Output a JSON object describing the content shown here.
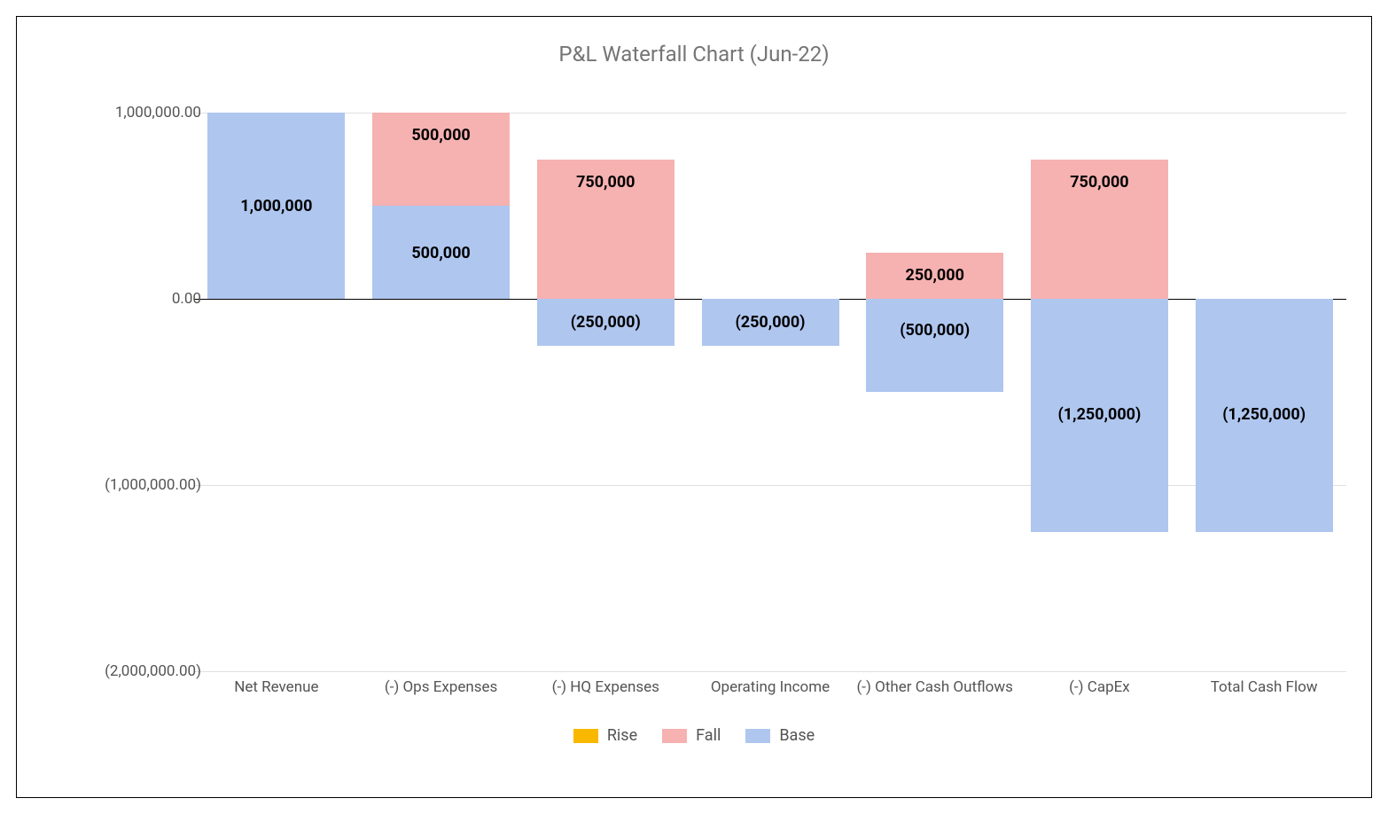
{
  "chart_data": {
    "type": "bar",
    "title": "P&L Waterfall Chart (Jun-22)",
    "ylim": [
      -2000000,
      1000000
    ],
    "yticks": [
      {
        "v": 1000000,
        "label": "1,000,000.00"
      },
      {
        "v": 0,
        "label": "0.00"
      },
      {
        "v": -1000000,
        "label": "(1,000,000.00)"
      },
      {
        "v": -2000000,
        "label": "(2,000,000.00)"
      }
    ],
    "categories": [
      "Net Revenue",
      "(-) Ops Expenses",
      "(-) HQ Expenses",
      "Operating Income",
      "(-) Other Cash Outflows",
      "(-) CapEx",
      "Total Cash Flow"
    ],
    "legend": [
      {
        "name": "Rise",
        "key": "rise"
      },
      {
        "name": "Fall",
        "key": "fall"
      },
      {
        "name": "Base",
        "key": "base"
      }
    ],
    "bars": [
      {
        "segments": [
          {
            "kind": "base",
            "from": 0,
            "to": 1000000,
            "label": "1,000,000",
            "labelAt": 500000
          }
        ]
      },
      {
        "segments": [
          {
            "kind": "base",
            "from": 0,
            "to": 500000,
            "label": "500,000",
            "labelAt": 250000
          },
          {
            "kind": "fall",
            "from": 500000,
            "to": 1000000,
            "label": "500,000",
            "labelAt": 880000
          }
        ]
      },
      {
        "segments": [
          {
            "kind": "base",
            "from": -250000,
            "to": 0,
            "label": "(250,000)",
            "labelAt": -125000
          },
          {
            "kind": "fall",
            "from": 0,
            "to": 750000,
            "label": "750,000",
            "labelAt": 630000
          }
        ]
      },
      {
        "segments": [
          {
            "kind": "base",
            "from": -250000,
            "to": 0,
            "label": "(250,000)",
            "labelAt": -125000
          }
        ]
      },
      {
        "segments": [
          {
            "kind": "base",
            "from": -500000,
            "to": 0,
            "label": "(500,000)",
            "labelAt": -165000
          },
          {
            "kind": "fall",
            "from": 0,
            "to": 250000,
            "label": "250,000",
            "labelAt": 130000
          }
        ]
      },
      {
        "segments": [
          {
            "kind": "base",
            "from": -1250000,
            "to": 0,
            "label": "(1,250,000)",
            "labelAt": -620000
          },
          {
            "kind": "fall",
            "from": 0,
            "to": 750000,
            "label": "750,000",
            "labelAt": 630000
          }
        ]
      },
      {
        "segments": [
          {
            "kind": "base",
            "from": -1250000,
            "to": 0,
            "label": "(1,250,000)",
            "labelAt": -620000
          }
        ]
      }
    ]
  }
}
